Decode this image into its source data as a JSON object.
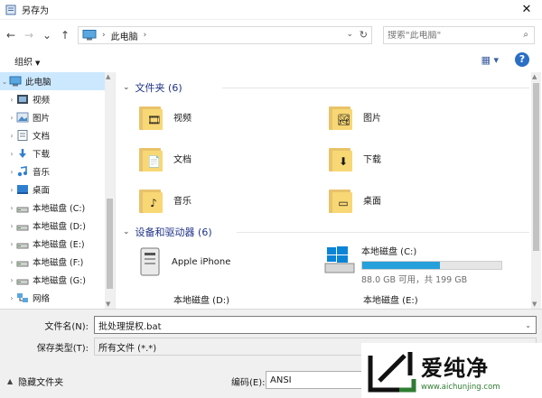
{
  "window": {
    "title": "另存为",
    "close_glyph": "✕"
  },
  "nav": {
    "back_glyph": "←",
    "forward_glyph": "→",
    "recent_glyph": "⌄",
    "up_glyph": "↑",
    "address_sep": "›",
    "address_crumb": "此电脑",
    "address_sep2": "›",
    "address_dropdown": "⌄",
    "refresh_glyph": "↻",
    "search_placeholder": "搜索\"此电脑\"",
    "search_glyph": "⌕"
  },
  "toolbar": {
    "organize_label": "组织",
    "organize_caret": "▼",
    "view_glyph": "▦ ▾",
    "help_glyph": "?"
  },
  "sidebar": {
    "items": [
      {
        "label": "此电脑",
        "chev": "⌄",
        "icon": "pc-icon",
        "selected": true
      },
      {
        "label": "视频",
        "chev": "›",
        "icon": "video-icon"
      },
      {
        "label": "图片",
        "chev": "›",
        "icon": "picture-icon"
      },
      {
        "label": "文档",
        "chev": "›",
        "icon": "document-icon"
      },
      {
        "label": "下载",
        "chev": "›",
        "icon": "download-icon"
      },
      {
        "label": "音乐",
        "chev": "›",
        "icon": "music-icon"
      },
      {
        "label": "桌面",
        "chev": "›",
        "icon": "desktop-icon"
      },
      {
        "label": "本地磁盘 (C:)",
        "chev": "›",
        "icon": "drive-icon"
      },
      {
        "label": "本地磁盘 (D:)",
        "chev": "›",
        "icon": "drive-icon"
      },
      {
        "label": "本地磁盘 (E:)",
        "chev": "›",
        "icon": "drive-icon"
      },
      {
        "label": "本地磁盘 (F:)",
        "chev": "›",
        "icon": "drive-icon"
      },
      {
        "label": "本地磁盘 (G:)",
        "chev": "›",
        "icon": "drive-icon"
      },
      {
        "label": "网络",
        "chev": "›",
        "icon": "network-icon"
      }
    ]
  },
  "main": {
    "folders_header": "文件夹 (6)",
    "devices_header": "设备和驱动器 (6)",
    "folders": [
      {
        "label": "视频",
        "emblem": "🎞"
      },
      {
        "label": "图片",
        "emblem": "🏞"
      },
      {
        "label": "文档",
        "emblem": "📄"
      },
      {
        "label": "下载",
        "emblem": "⬇"
      },
      {
        "label": "音乐",
        "emblem": "♪"
      },
      {
        "label": "桌面",
        "emblem": "▭"
      }
    ],
    "devices": {
      "iphone_label": "Apple iPhone",
      "drive_c_label": "本地磁盘 (C:)",
      "drive_c_sub": "88.0 GB 可用，共 199 GB",
      "drive_c_used_fraction": 0.558,
      "drive_d_label": "本地磁盘 (D:)",
      "drive_e_label": "本地磁盘 (E:)"
    }
  },
  "form": {
    "filename_label": "文件名(N):",
    "filename_value": "批处理提权.bat",
    "filetype_label": "保存类型(T):",
    "filetype_value": "所有文件  (*.*)",
    "dropdown_glyph": "⌄",
    "hide_folders_caret": "▲",
    "hide_folders_label": "隐藏文件夹",
    "encoding_label": "编码(E):",
    "encoding_value": "ANSI"
  },
  "watermark": {
    "title": "爱纯净",
    "url": "www.aichunjing.com"
  },
  "colors": {
    "selection": "#cce8ff",
    "group_header": "#1e3287",
    "drive_bar": "#26a0da",
    "accent_help": "#2b6fc4"
  }
}
